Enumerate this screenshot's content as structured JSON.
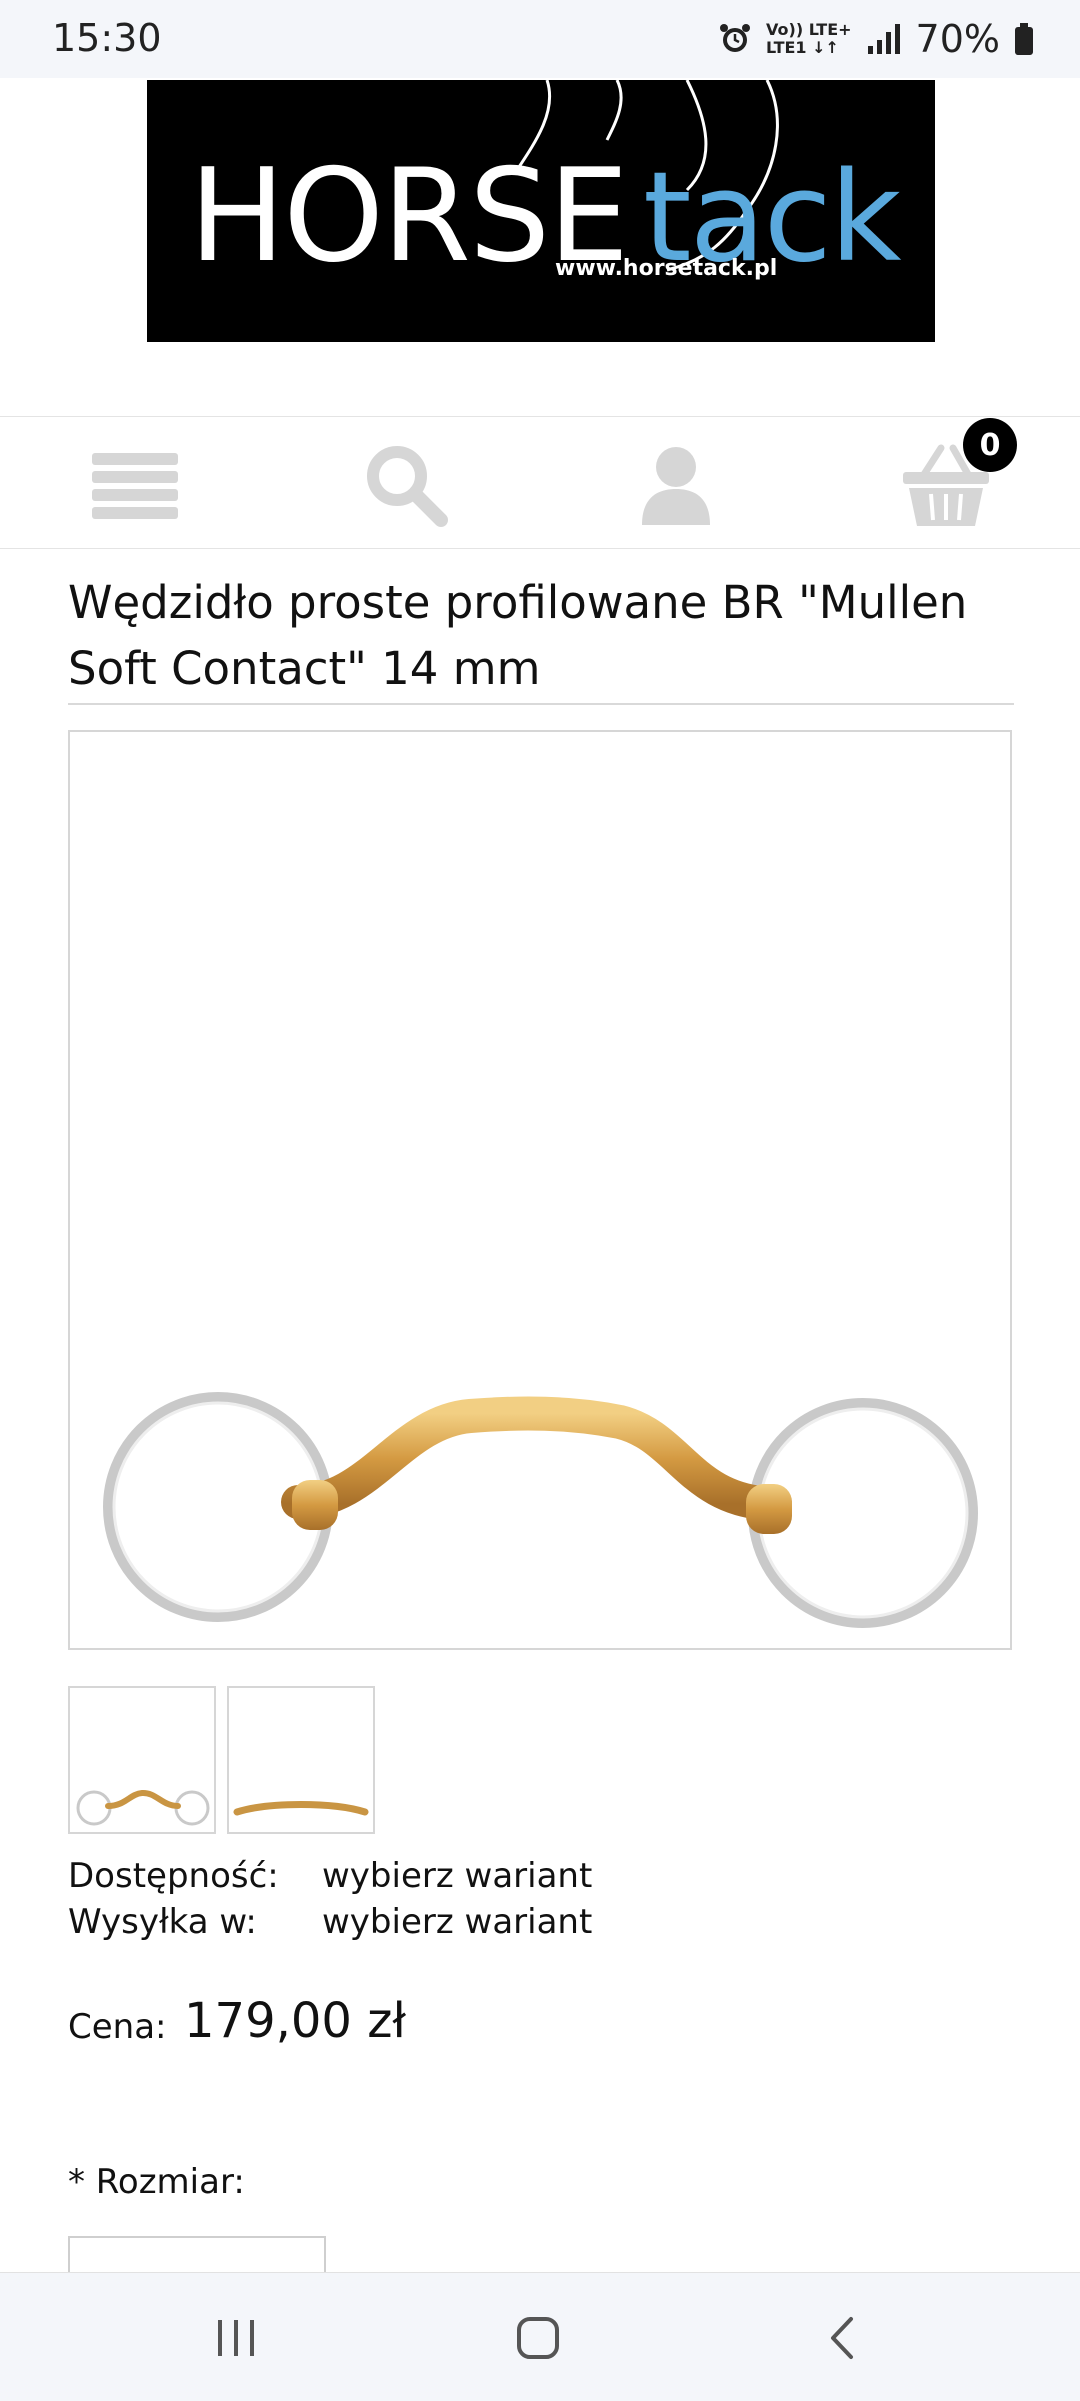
{
  "status_bar": {
    "time": "15:30",
    "battery": "70%",
    "network_line1": "Vo)) LTE+",
    "network_line2": "LTE1 ↓↑"
  },
  "logo": {
    "word1": "HORSE",
    "word2": "tack",
    "url": "www.horsetack.pl"
  },
  "nav": {
    "cart_count": "0",
    "icons": [
      "menu-icon",
      "search-icon",
      "user-icon",
      "cart-icon"
    ]
  },
  "product": {
    "title": "Wędzidło proste profilowane BR \"Mullen Soft Contact\" 14 mm",
    "availability_label": "Dostępność:",
    "availability_value": "wybierz wariant",
    "shipping_label": "Wysyłka w:",
    "shipping_value": "wybierz wariant",
    "price_label": "Cena:",
    "price_value": "179,00 zł",
    "size_label": "* Rozmiar:"
  },
  "colors": {
    "brand_blue": "#5aa9dd",
    "icon_gray": "#d6d6d6"
  }
}
